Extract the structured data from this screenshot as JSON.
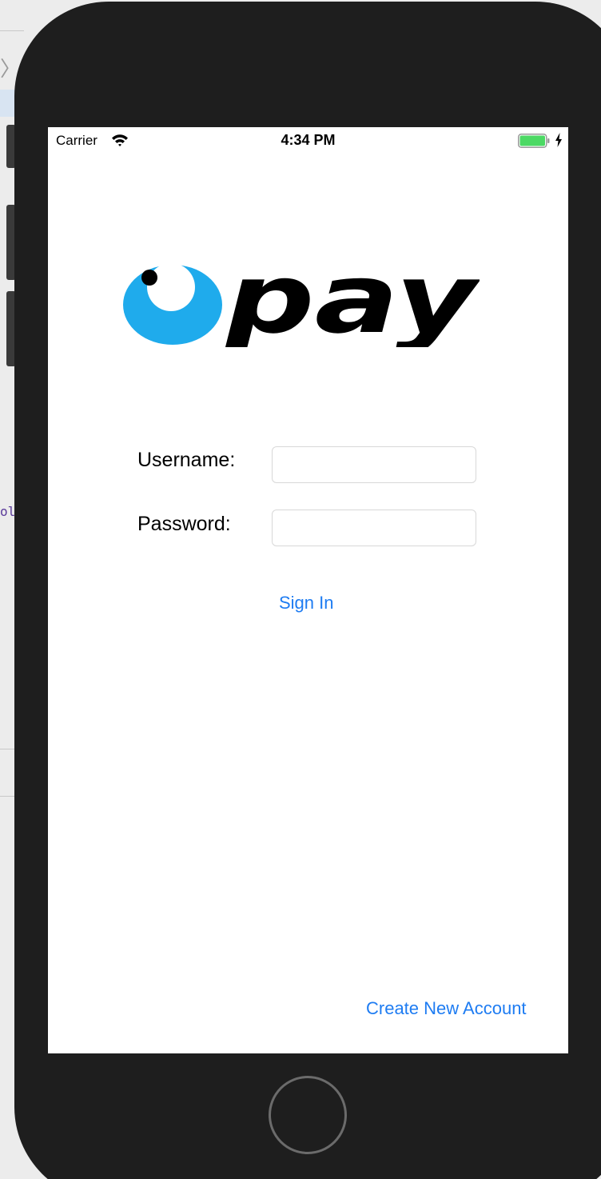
{
  "status_bar": {
    "carrier": "Carrier",
    "time": "4:34 PM",
    "wifi_icon": "wifi-icon",
    "battery_icon": "battery-full-icon",
    "charging_icon": "charging-bolt-icon"
  },
  "logo": {
    "text": "pay",
    "icon": "blue-bubble-eye-icon",
    "brand_color": "#1fabec"
  },
  "form": {
    "username_label": "Username:",
    "username_value": "",
    "password_label": "Password:",
    "password_value": "",
    "sign_in_label": "Sign In"
  },
  "footer": {
    "create_account_label": "Create New Account"
  },
  "colors": {
    "link": "#1e7cf2",
    "battery": "#4cd964",
    "device": "#1e1e1e"
  },
  "background": {
    "code_fragment": "ol"
  }
}
